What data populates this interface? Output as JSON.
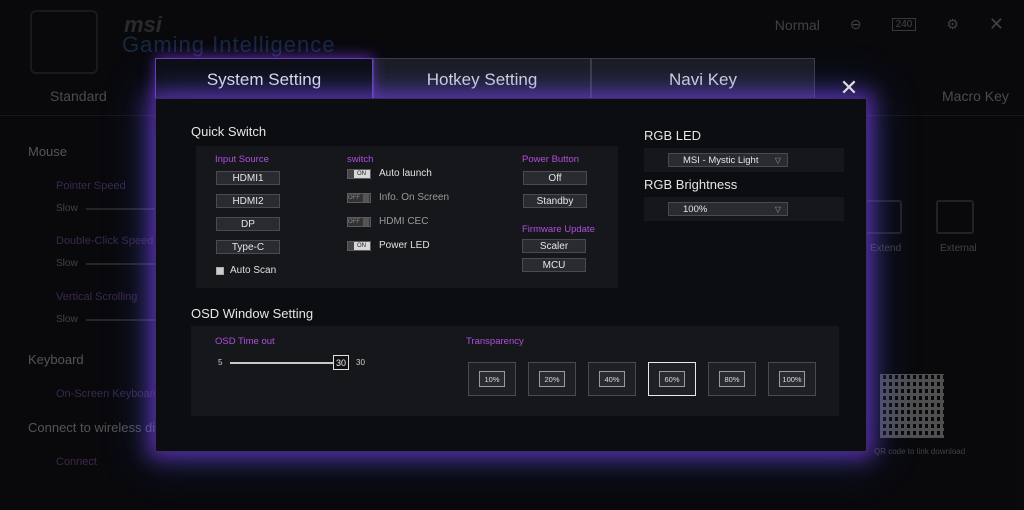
{
  "background": {
    "brand": "msi",
    "app_title": "Gaming Intelligence",
    "tabs": [
      "Standard",
      "Macro Key"
    ],
    "sidebar": {
      "mouse": "Mouse",
      "pointer_speed": "Pointer Speed",
      "double_click_speed": "Double-Click Speed",
      "vertical_scrolling": "Vertical Scrolling",
      "slow": "Slow",
      "keyboard": "Keyboard",
      "on_screen_keyboard": "On-Screen Keyboard",
      "connect_wireless": "Connect to wireless disp",
      "connect": "Connect"
    },
    "right": {
      "extend": "Extend",
      "external": "External",
      "qr_caption": "QR code to link download"
    },
    "topbar": {
      "mode": "Normal",
      "refresh": "240"
    }
  },
  "modal": {
    "tabs": {
      "system": "System Setting",
      "hotkey": "Hotkey Setting",
      "navi": "Navi Key"
    },
    "close": "✕",
    "quick_switch": {
      "title": "Quick Switch",
      "input_source": {
        "label": "Input Source",
        "options": [
          "HDMI1",
          "HDMI2",
          "DP",
          "Type-C"
        ],
        "auto_scan": "Auto Scan"
      },
      "switch": {
        "label": "switch",
        "items": [
          {
            "label": "Auto launch",
            "state": "ON"
          },
          {
            "label": "Info. On Screen",
            "state": "OFF"
          },
          {
            "label": "HDMI CEC",
            "state": "OFF"
          },
          {
            "label": "Power LED",
            "state": "ON"
          }
        ]
      },
      "power_button": {
        "label": "Power Button",
        "options": [
          "Off",
          "Standby"
        ]
      },
      "firmware_update": {
        "label": "Firmware Update",
        "options": [
          "Scaler",
          "MCU"
        ]
      }
    },
    "rgb": {
      "led_title": "RGB LED",
      "led_value": "MSI - Mystic Light",
      "brightness_title": "RGB Brightness",
      "brightness_value": "100%"
    },
    "osd": {
      "title": "OSD Window Setting",
      "timeout_label": "OSD Time out",
      "min": "5",
      "max": "30",
      "value": "30",
      "value_num": 30,
      "transparency_label": "Transparency",
      "transparency_options": [
        "10%",
        "20%",
        "40%",
        "60%",
        "80%",
        "100%"
      ],
      "transparency_selected": "60%"
    }
  }
}
